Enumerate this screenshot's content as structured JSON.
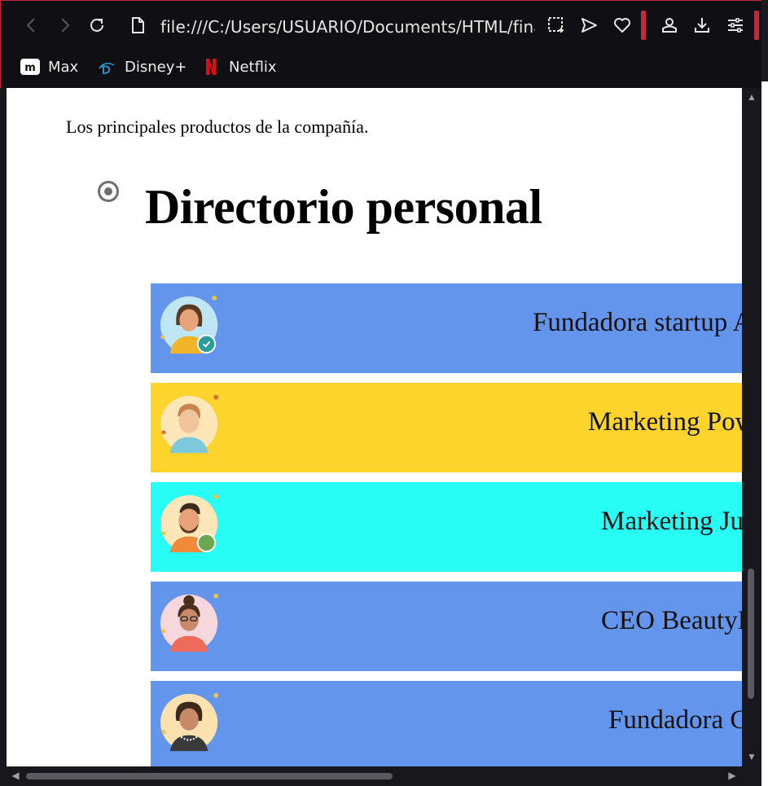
{
  "browser": {
    "url": "file:///C:/Users/USUARIO/Documents/HTML/finalP",
    "bookmarks": [
      {
        "label": "Max",
        "icon": "max-logo-icon"
      },
      {
        "label": "Disney+",
        "icon": "disney-plus-logo-icon"
      },
      {
        "label": "Netflix",
        "icon": "netflix-logo-icon"
      }
    ],
    "accent": "#c4283c"
  },
  "page": {
    "intro_text": "Los principales productos de la compañía.",
    "heading": "Directorio personal",
    "directory": [
      {
        "title": "Fundadora startup A",
        "color": "#6495ed",
        "avatar": "woman-avatar-icon"
      },
      {
        "title": "Marketing Pow",
        "color": "#fdd42b",
        "avatar": "man-avatar-icon"
      },
      {
        "title": "Marketing Ju",
        "color": "#27fcf5",
        "avatar": "bearded-man-avatar-icon"
      },
      {
        "title": "CEO BeautyN",
        "color": "#6495ed",
        "avatar": "woman-bun-avatar-icon"
      },
      {
        "title": "Fundadora C",
        "color": "#6495ed",
        "avatar": "woman-curly-avatar-icon"
      }
    ]
  }
}
